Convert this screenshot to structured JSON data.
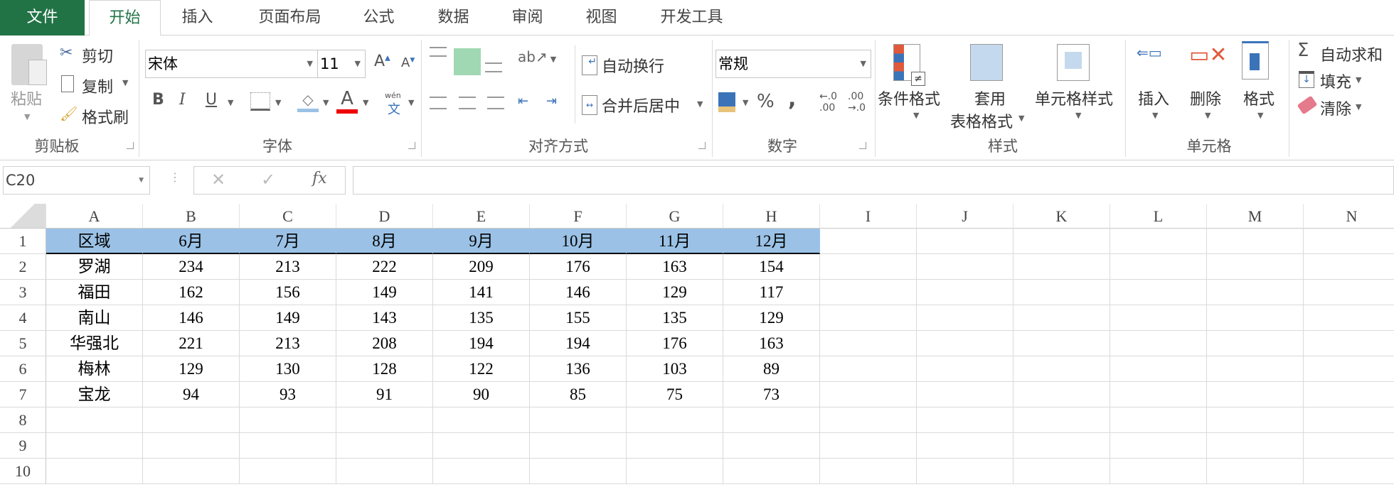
{
  "tabs": [
    "文件",
    "开始",
    "插入",
    "页面布局",
    "公式",
    "数据",
    "审阅",
    "视图",
    "开发工具"
  ],
  "clipboard": {
    "paste": "粘贴",
    "cut": "剪切",
    "copy": "复制",
    "format_painter": "格式刷",
    "label": "剪贴板"
  },
  "font": {
    "name": "宋体",
    "size": "11",
    "bold": "B",
    "italic": "I",
    "underline": "U",
    "font_color": "A",
    "phonetic_top": "wén",
    "phonetic_bottom": "文",
    "label": "字体"
  },
  "alignment": {
    "wrap_text": "自动换行",
    "merge_center": "合并后居中",
    "label": "对齐方式"
  },
  "number": {
    "format": "常规",
    "percent": "%",
    "comma": ",",
    "inc_decimal": "←.0 .00",
    "dec_decimal": ".00 →.0",
    "label": "数字"
  },
  "styles": {
    "conditional": "条件格式",
    "table_format_1": "套用",
    "table_format_2": "表格格式",
    "cell_styles": "单元格样式",
    "label": "样式"
  },
  "cells": {
    "insert": "插入",
    "delete": "删除",
    "format": "格式",
    "label": "单元格"
  },
  "editing": {
    "autosum": "自动求和",
    "fill": "填充",
    "clear": "清除"
  },
  "formula_bar": {
    "name_box": "C20",
    "cancel": "✕",
    "enter": "✓",
    "fx": "fx",
    "formula": ""
  },
  "colors": {
    "accent": "#217346",
    "header_fill": "#9bc2e6"
  },
  "sheet": {
    "columns": [
      "A",
      "B",
      "C",
      "D",
      "E",
      "F",
      "G",
      "H",
      "I",
      "J",
      "K",
      "L",
      "M",
      "N"
    ],
    "row_numbers": [
      "1",
      "2",
      "3",
      "4",
      "5",
      "6",
      "7",
      "8",
      "9",
      "10"
    ],
    "rows": [
      [
        "区域",
        "6月",
        "7月",
        "8月",
        "9月",
        "10月",
        "11月",
        "12月"
      ],
      [
        "罗湖",
        "234",
        "213",
        "222",
        "209",
        "176",
        "163",
        "154"
      ],
      [
        "福田",
        "162",
        "156",
        "149",
        "141",
        "146",
        "129",
        "117"
      ],
      [
        "南山",
        "146",
        "149",
        "143",
        "135",
        "155",
        "135",
        "129"
      ],
      [
        "华强北",
        "221",
        "213",
        "208",
        "194",
        "194",
        "176",
        "163"
      ],
      [
        "梅林",
        "129",
        "130",
        "128",
        "122",
        "136",
        "103",
        "89"
      ],
      [
        "宝龙",
        "94",
        "93",
        "91",
        "90",
        "85",
        "75",
        "73"
      ]
    ]
  }
}
